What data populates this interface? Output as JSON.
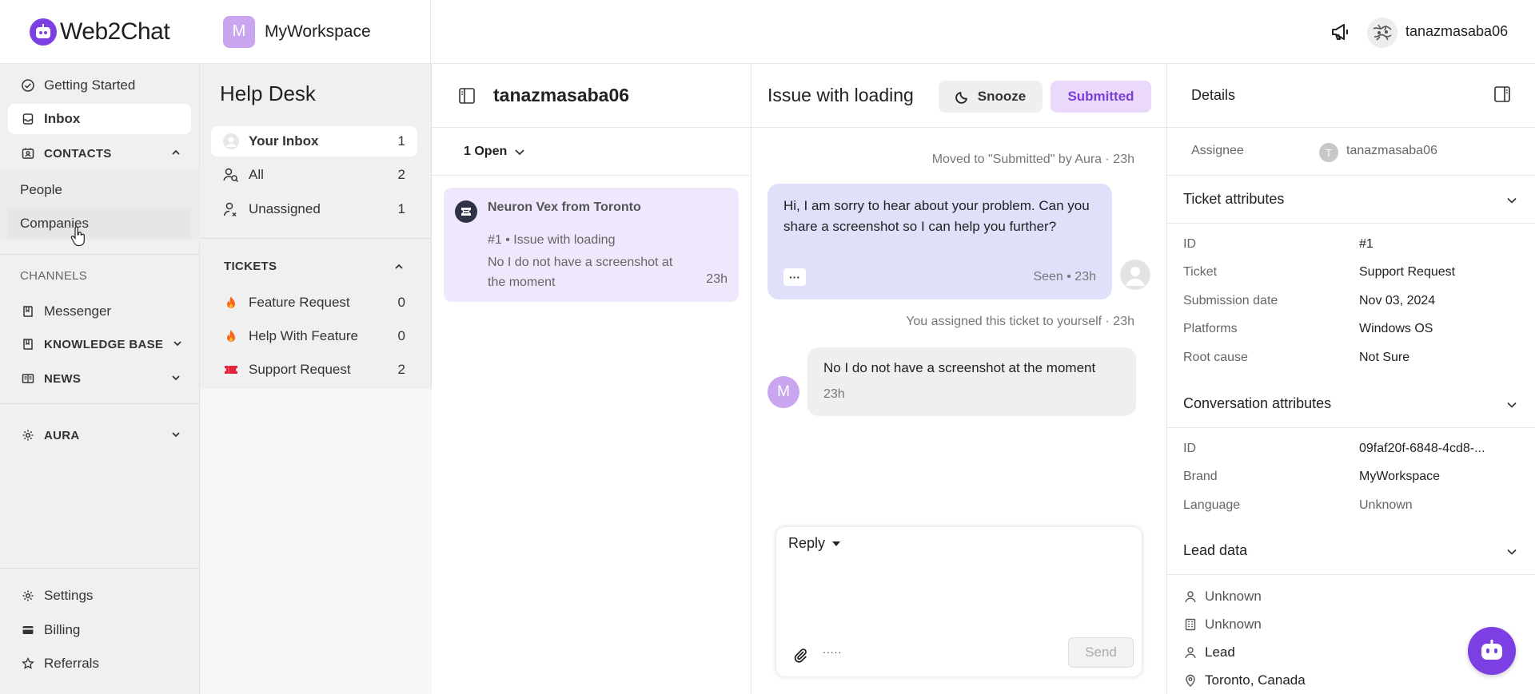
{
  "brand": {
    "name": "Web2Chat",
    "accent": "#7b3fe4"
  },
  "workspace": {
    "initial": "M",
    "name": "MyWorkspace"
  },
  "topbar": {
    "user_name": "tanazmasaba06"
  },
  "nav": {
    "getting_started": "Getting Started",
    "inbox": "Inbox",
    "contacts": "CONTACTS",
    "people": "People",
    "companies": "Companies",
    "channels_label": "CHANNELS",
    "messenger": "Messenger",
    "knowledge_base": "KNOWLEDGE BASE",
    "news": "NEWS",
    "aura": "AURA",
    "settings": "Settings",
    "billing": "Billing",
    "referrals": "Referrals"
  },
  "helpdesk": {
    "title": "Help Desk",
    "inboxes": [
      {
        "label": "Your Inbox",
        "count": "1"
      },
      {
        "label": "All",
        "count": "2"
      },
      {
        "label": "Unassigned",
        "count": "1"
      }
    ],
    "tickets_label": "TICKETS",
    "tickets": [
      {
        "label": "Feature Request",
        "count": "0"
      },
      {
        "label": "Help With Feature",
        "count": "0"
      },
      {
        "label": "Support Request",
        "count": "2"
      }
    ]
  },
  "conv_list": {
    "title": "tanazmasaba06",
    "filter": "1 Open",
    "items": [
      {
        "name": "Neuron Vex from Toronto",
        "subtitle": "#1 • Issue with loading",
        "preview": "No I do not have a screenshot at the moment",
        "time": "23h"
      }
    ]
  },
  "chat": {
    "title": "Issue with loading",
    "snooze_label": "Snooze",
    "status_label": "Submitted",
    "sys_moved": "Moved to \"Submitted\" by Aura · 23h",
    "agent_msg": "Hi, I am sorry to hear about your problem. Can you share a screenshot so I can help you further?",
    "agent_dots": "···",
    "agent_meta": "Seen • 23h",
    "sys_assigned": "You assigned this ticket to yourself · 23h",
    "user_initial": "M",
    "user_msg": "No I do not have a screenshot at the moment",
    "user_time": "23h",
    "reply_label": "Reply",
    "reply_placeholder": "",
    "more_label": ".....",
    "send_label": "Send"
  },
  "details": {
    "title": "Details",
    "assignee_label": "Assignee",
    "assignee_initial": "T",
    "assignee_name": "tanazmasaba06",
    "ticket_attributes_title": "Ticket attributes",
    "ticket_attributes": [
      {
        "label": "ID",
        "value": "#1"
      },
      {
        "label": "Ticket",
        "value": "Support Request"
      },
      {
        "label": "Submission date",
        "value": "Nov 03, 2024"
      },
      {
        "label": "Platforms",
        "value": "Windows OS"
      },
      {
        "label": "Root cause",
        "value": "Not Sure"
      }
    ],
    "conversation_attributes_title": "Conversation attributes",
    "conversation_attributes": [
      {
        "label": "ID",
        "value": "09faf20f-6848-4cd8-..."
      },
      {
        "label": "Brand",
        "value": "MyWorkspace"
      },
      {
        "label": "Language",
        "value": "Unknown"
      }
    ],
    "lead_data_title": "Lead data",
    "lead_data": [
      {
        "icon": "person-icon",
        "value": "Unknown"
      },
      {
        "icon": "building-icon",
        "value": "Unknown"
      },
      {
        "icon": "person-icon",
        "value": "Lead"
      },
      {
        "icon": "location-pin-icon",
        "value": "Toronto, Canada"
      }
    ]
  }
}
